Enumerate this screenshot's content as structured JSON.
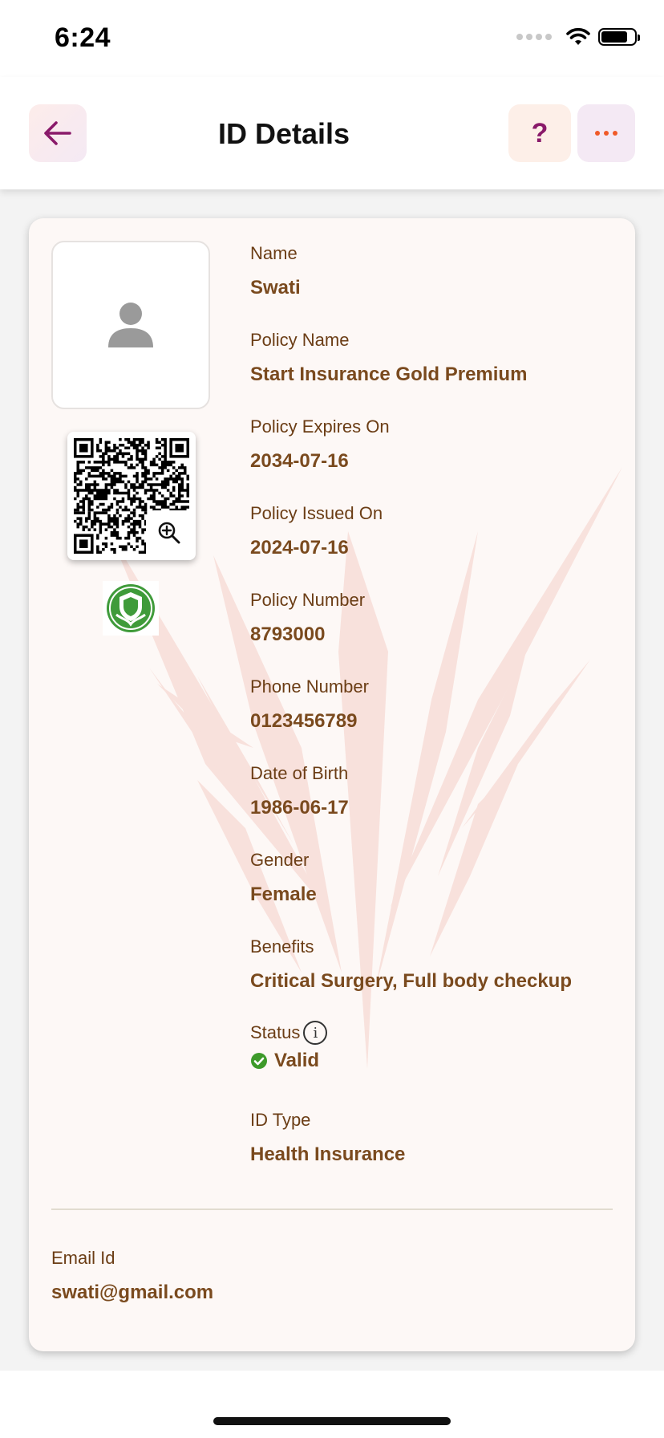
{
  "status_bar": {
    "time": "6:24"
  },
  "header": {
    "title": "ID Details",
    "help_label": "?"
  },
  "card": {
    "fields": [
      {
        "label": "Name",
        "value": "Swati"
      },
      {
        "label": "Policy Name",
        "value": "Start Insurance Gold Premium"
      },
      {
        "label": "Policy Expires On",
        "value": "2034-07-16"
      },
      {
        "label": "Policy Issued On",
        "value": "2024-07-16"
      },
      {
        "label": "Policy Number",
        "value": "8793000"
      },
      {
        "label": "Phone Number",
        "value": "0123456789"
      },
      {
        "label": "Date of Birth",
        "value": "1986-06-17"
      },
      {
        "label": "Gender",
        "value": "Female"
      },
      {
        "label": "Benefits",
        "value": "Critical Surgery, Full body checkup"
      }
    ],
    "status": {
      "label": "Status",
      "value": "Valid",
      "info_icon_glyph": "i"
    },
    "id_type": {
      "label": "ID Type",
      "value": "Health Insurance"
    },
    "email": {
      "label": "Email Id",
      "value": "swati@gmail.com"
    }
  },
  "icons": {
    "back": "arrow-left-icon",
    "help": "question-icon",
    "more": "more-horizontal-icon",
    "avatar": "person-placeholder-icon",
    "qr": "qr-code",
    "zoom": "zoom-in-icon",
    "issuer_logo": "shield-logo-icon",
    "valid": "check-circle-icon",
    "info": "info-icon"
  },
  "colors": {
    "accent": "#8a1a6a",
    "more_dots": "#f05a28",
    "label_text": "#6b3d15",
    "value_text": "#7a4a1e",
    "valid_green": "#3d9a2a",
    "card_bg": "#fdf8f6"
  }
}
